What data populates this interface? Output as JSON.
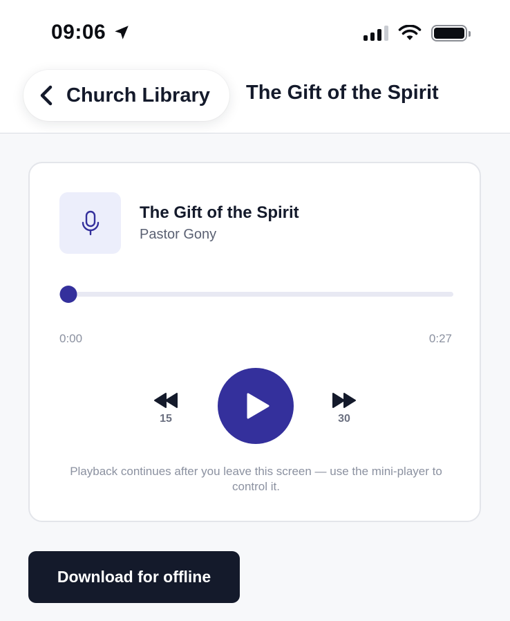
{
  "status_bar": {
    "time": "09:06",
    "location_icon": "location-arrow-icon",
    "signal_icon": "cellular-signal-icon",
    "wifi_icon": "wifi-icon",
    "battery_icon": "battery-icon"
  },
  "nav": {
    "back_label": "Church Library",
    "back_icon": "chevron-left-icon",
    "title": "The Gift of the Spirit"
  },
  "player": {
    "artwork_icon": "microphone-icon",
    "title": "The Gift of the Spirit",
    "artist": "Pastor Gony",
    "progress": 0,
    "current_time": "0:00",
    "duration": "0:27",
    "skip_back_seconds": "15",
    "skip_forward_seconds": "30",
    "play_icon": "play-icon",
    "hint": "Playback continues after you leave this screen — use the mini-player to control it."
  },
  "download_label": "Download for offline",
  "colors": {
    "accent": "#34309c",
    "text_primary": "#141a2b",
    "text_muted": "#8b91a0",
    "button_dark": "#141a2b"
  }
}
